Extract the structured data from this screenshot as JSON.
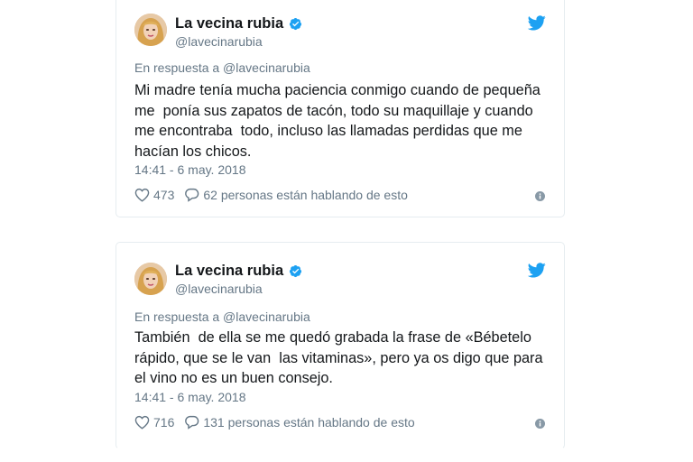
{
  "tweets": [
    {
      "author": {
        "name": "La vecina rubia",
        "handle": "@lavecinarubia"
      },
      "reply_to": "En respuesta a @lavecinarubia",
      "text": "Mi madre tenía mucha paciencia conmigo cuando de pequeña\nme  ponía sus zapatos de tacón, todo su maquillaje y cuando\nme encontraba  todo, incluso las llamadas perdidas que me\nhacían los chicos.",
      "timestamp": "14:41 - 6 may. 2018",
      "likes": "473",
      "conversation": "62 personas están hablando de esto"
    },
    {
      "author": {
        "name": "La vecina rubia",
        "handle": "@lavecinarubia"
      },
      "reply_to": "En respuesta a @lavecinarubia",
      "text": "También  de ella se me quedó grabada la frase de «Bébetelo\nrápido, que se le van  las vitaminas», pero ya os digo que para\nel vino no es un buen consejo.",
      "timestamp": "14:41 - 6 may. 2018",
      "likes": "716",
      "conversation": "131 personas están hablando de esto"
    }
  ],
  "icons": {
    "verified": "verified-badge-icon",
    "bird": "twitter-bird-icon",
    "like": "heart-icon",
    "reply": "speech-bubble-icon",
    "info": "info-icon"
  },
  "colors": {
    "brand_blue": "#1da1f2",
    "text": "#14171a",
    "secondary_text": "#657786",
    "border": "#e6ecf0"
  }
}
